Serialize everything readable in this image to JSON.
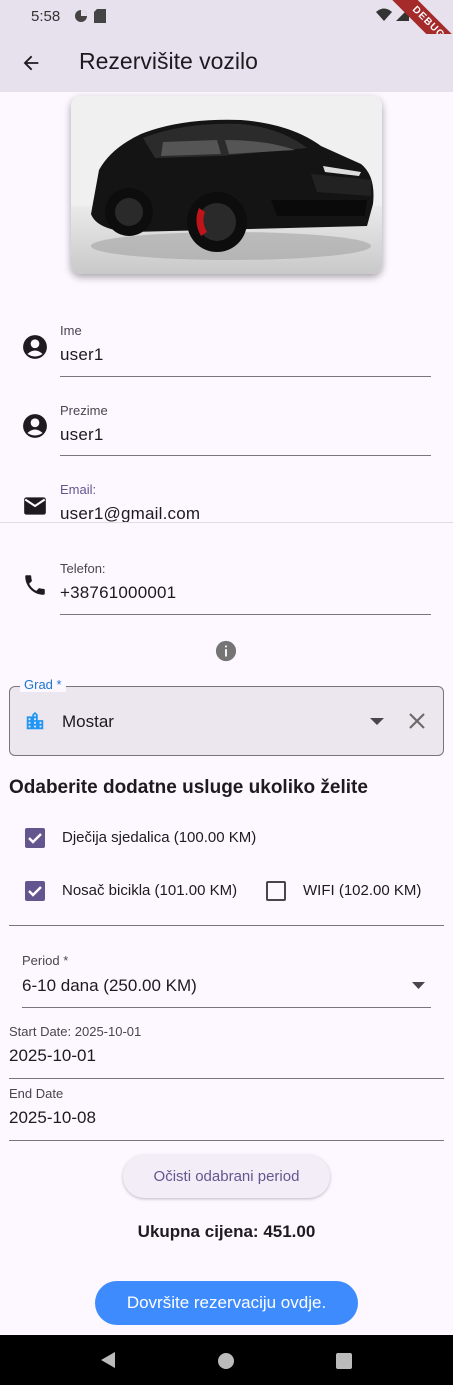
{
  "status_bar": {
    "time": "5:58",
    "debug_banner": "DEBUG"
  },
  "app_bar": {
    "title": "Rezervišite vozilo"
  },
  "form": {
    "first_name": {
      "label": "Ime",
      "value": "user1"
    },
    "last_name": {
      "label": "Prezime",
      "value": "user1"
    },
    "email": {
      "label": "Email:",
      "value": "user1@gmail.com"
    },
    "phone": {
      "label": "Telefon:",
      "value": "+38761000001"
    }
  },
  "city": {
    "label": "Grad *",
    "value": "Mostar"
  },
  "services": {
    "title": "Odaberite dodatne usluge ukoliko želite",
    "items": [
      {
        "label": "Dječija sjedalica (100.00 KM)",
        "checked": true
      },
      {
        "label": "Nosač bicikla (101.00 KM)",
        "checked": true
      },
      {
        "label": "WIFI (102.00 KM)",
        "checked": false
      }
    ]
  },
  "period": {
    "label": "Period *",
    "value": "6-10 dana (250.00 KM)"
  },
  "start_date": {
    "label": "Start Date: 2025-10-01",
    "value": "2025-10-01"
  },
  "end_date": {
    "label": "End Date",
    "value": "2025-10-08"
  },
  "clear_period_button": "Očisti odabrani period",
  "total": "Ukupna cijena: 451.00",
  "submit_button": "Dovršite rezervaciju ovdje.",
  "colors": {
    "accent": "#65558f",
    "primary_button": "#3d8bfd",
    "city_label": "#1976d2",
    "app_bar": "#e7e1ee"
  }
}
